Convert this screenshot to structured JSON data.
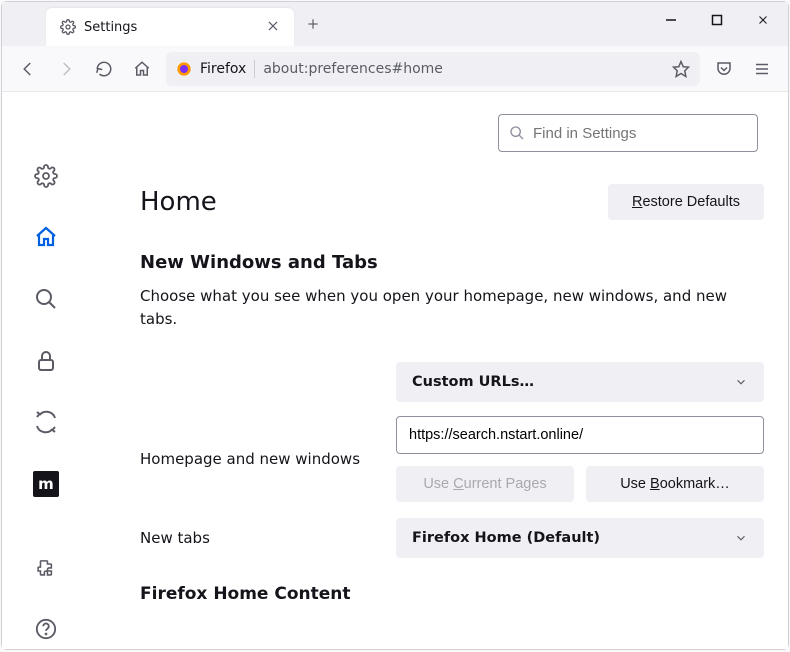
{
  "tab": {
    "title": "Settings"
  },
  "toolbar": {
    "site_label": "Firefox",
    "url": "about:preferences#home"
  },
  "sidebar": {
    "m_label": "m"
  },
  "search_settings": {
    "placeholder": "Find in Settings"
  },
  "page": {
    "heading": "Home",
    "restore_defaults_leading": "R",
    "restore_defaults_rest": "estore Defaults",
    "section_new_windows_tabs": "New Windows and Tabs",
    "description": "Choose what you see when you open your homepage, new windows, and new tabs.",
    "homepage_label": "Homepage and new windows",
    "homepage_select": "Custom URLs…",
    "homepage_url_value": "https://search.nstart.online/",
    "use_current_pre": "Use ",
    "use_current_u": "C",
    "use_current_post": "urrent Pages",
    "use_bookmark_pre": "Use ",
    "use_bookmark_u": "B",
    "use_bookmark_post": "ookmark…",
    "newtabs_label": "New tabs",
    "newtabs_select": "Firefox Home (Default)",
    "section_home_content": "Firefox Home Content"
  }
}
